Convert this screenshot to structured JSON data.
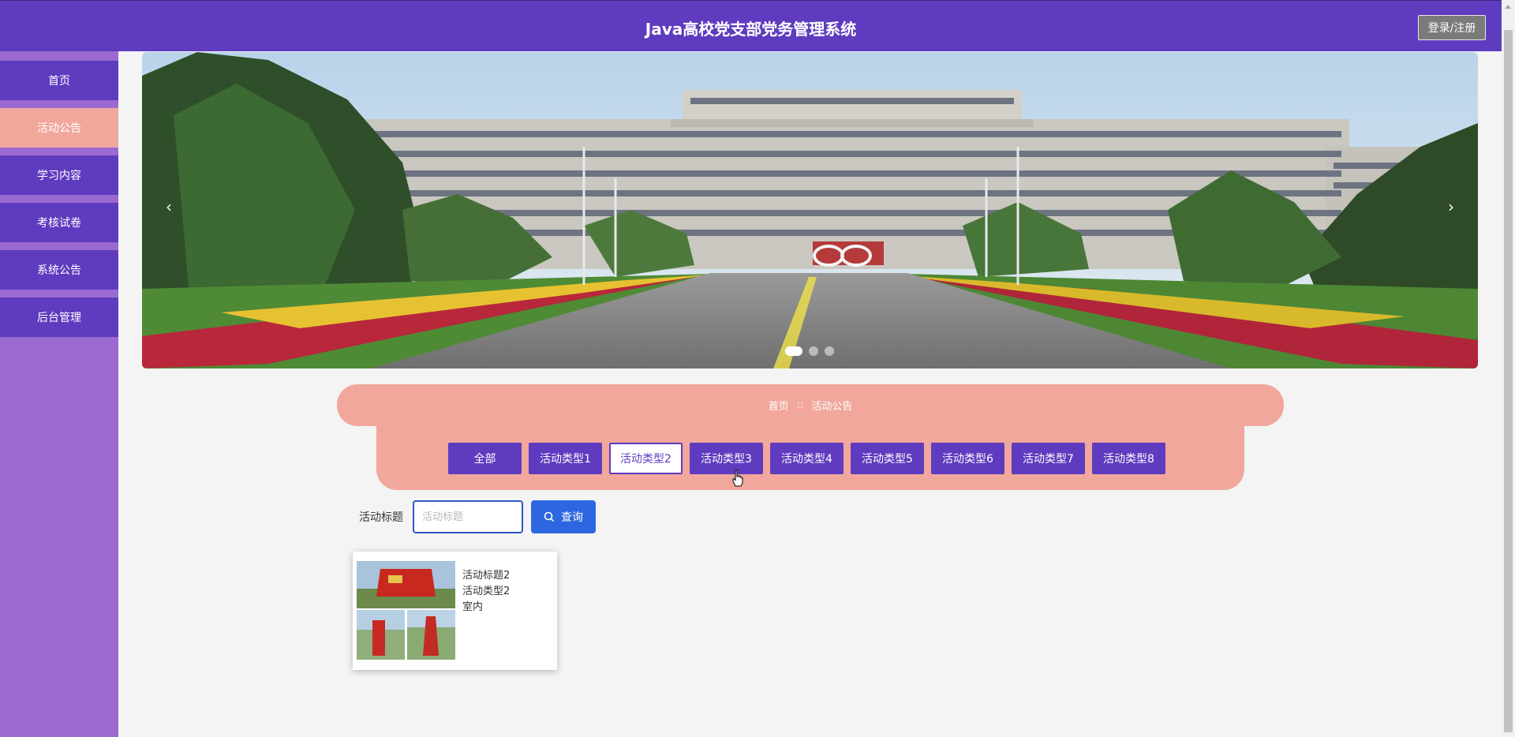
{
  "header": {
    "title": "Java高校党支部党务管理系统",
    "login_label": "登录/注册"
  },
  "sidebar": {
    "items": [
      {
        "label": "首页",
        "active": false
      },
      {
        "label": "活动公告",
        "active": true
      },
      {
        "label": "学习内容",
        "active": false
      },
      {
        "label": "考核试卷",
        "active": false
      },
      {
        "label": "系统公告",
        "active": false
      },
      {
        "label": "后台管理",
        "active": false
      }
    ]
  },
  "banner": {
    "prev_icon": "‹",
    "next_icon": "›",
    "slide_count": 3,
    "active_slide": 1
  },
  "breadcrumb": {
    "home": "首页",
    "separator": "::",
    "current": "活动公告"
  },
  "categories": {
    "items": [
      "全部",
      "活动类型1",
      "活动类型2",
      "活动类型3",
      "活动类型4",
      "活动类型5",
      "活动类型6",
      "活动类型7",
      "活动类型8"
    ],
    "selected": "活动类型2"
  },
  "search": {
    "label": "活动标题",
    "placeholder": "活动标题",
    "value": "",
    "button_label": "查询",
    "button_icon": "search-icon"
  },
  "results": [
    {
      "title": "活动标题2",
      "type": "活动类型2",
      "location": "室内"
    }
  ],
  "colors": {
    "primary": "#5f3bbf",
    "accent": "#f1a79c",
    "sidebar_bg": "#9b6ad0",
    "search_blue": "#2d66e0"
  }
}
